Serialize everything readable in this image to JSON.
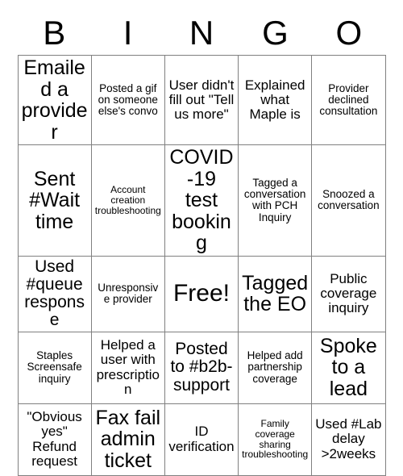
{
  "header": {
    "letters": [
      "B",
      "I",
      "N",
      "G",
      "O"
    ]
  },
  "grid": {
    "columns": 5,
    "rows": 5,
    "cells": [
      [
        {
          "text": "Emailed a provider",
          "size": "s-xl"
        },
        {
          "text": "Posted a gif on someone else's convo",
          "size": "s-sm"
        },
        {
          "text": "User didn't fill out \"Tell us more\"",
          "size": "s-md"
        },
        {
          "text": "Explained what Maple is",
          "size": "s-md"
        },
        {
          "text": "Provider declined consultation",
          "size": "s-sm"
        }
      ],
      [
        {
          "text": "Sent #Wait time",
          "size": "s-xl"
        },
        {
          "text": "Account creation troubleshooting",
          "size": "s-xs"
        },
        {
          "text": "COVID-19 test booking",
          "size": "s-xl"
        },
        {
          "text": "Tagged a conversation with PCH Inquiry",
          "size": "s-sm"
        },
        {
          "text": "Snoozed a conversation",
          "size": "s-sm"
        }
      ],
      [
        {
          "text": "Used #queue response",
          "size": "s-lg"
        },
        {
          "text": "Unresponsive provider",
          "size": "s-sm"
        },
        {
          "text": "Free!",
          "size": "s-free"
        },
        {
          "text": "Tagged the EO",
          "size": "s-xl"
        },
        {
          "text": "Public coverage inquiry",
          "size": "s-md"
        }
      ],
      [
        {
          "text": "Staples Screensafe inquiry",
          "size": "s-sm"
        },
        {
          "text": "Helped a user with prescription",
          "size": "s-md"
        },
        {
          "text": "Posted to #b2b-support",
          "size": "s-lg"
        },
        {
          "text": "Helped add partnership coverage",
          "size": "s-sm"
        },
        {
          "text": "Spoke to a lead",
          "size": "s-xl"
        }
      ],
      [
        {
          "text": "\"Obvious yes\" Refund request",
          "size": "s-md"
        },
        {
          "text": "Fax fail admin ticket",
          "size": "s-xl"
        },
        {
          "text": "ID verification",
          "size": "s-md"
        },
        {
          "text": "Family coverage sharing troubleshooting",
          "size": "s-xs"
        },
        {
          "text": "Used #Lab delay >2weeks",
          "size": "s-md"
        }
      ]
    ]
  }
}
